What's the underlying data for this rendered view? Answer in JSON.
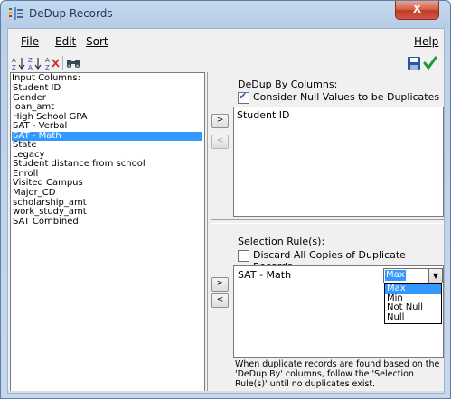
{
  "window": {
    "title": "DeDup Records",
    "close_glyph": "X"
  },
  "menu": {
    "file": "File",
    "edit": "Edit",
    "sort": "Sort",
    "help": "Help"
  },
  "toolbar": {
    "icons": [
      "sort-ascending-icon",
      "sort-descending-icon",
      "clear-sort-icon",
      "binoculars-find-icon",
      "save-icon",
      "checkmark-ok-icon"
    ]
  },
  "input_columns": {
    "label": "Input Columns:",
    "items": [
      "Student ID",
      "Gender",
      "loan_amt",
      "High School GPA",
      "SAT - Verbal",
      "SAT - Math",
      "State",
      "Legacy",
      "Student distance from school",
      "Enroll",
      "Visited Campus",
      "Major_CD",
      "scholarship_amt",
      "work_study_amt",
      "SAT Combined"
    ],
    "selected_index": 5
  },
  "dedup_by": {
    "label": "DeDup By Columns:",
    "null_checkbox_label": "Consider Null Values to be Duplicates",
    "null_checked": true,
    "columns": [
      "Student ID"
    ],
    "add_button": ">",
    "remove_button": "<"
  },
  "selection_rules": {
    "label": "Selection Rule(s):",
    "discard_checkbox_label": "Discard All Copies of Duplicate Records",
    "discard_checked": false,
    "rule_column": "SAT - Math",
    "rule_value": "Max",
    "options": [
      "Max",
      "Min",
      "Not Null",
      "Null"
    ],
    "add_button": ">",
    "remove_button": "<"
  },
  "help_text": "When duplicate records are found based on the 'DeDup By' columns, follow the 'Selection Rule(s)' until no duplicates exist.",
  "colors": {
    "selection": "#3399ff",
    "title_text": "#1e395b",
    "close_button": "#c13b22"
  }
}
